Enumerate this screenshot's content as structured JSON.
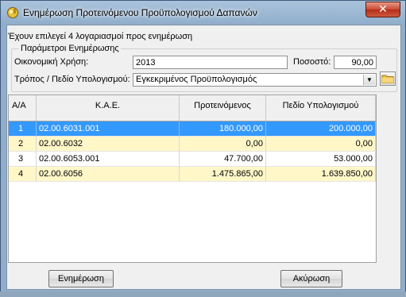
{
  "window": {
    "title": "Ενημέρωση Προτεινόμενου Προϋπολογισμού Δαπανών",
    "close_label": "✕"
  },
  "info_text": "Έχουν επιλεγεί 4 λογαριασμοί προς ενημέρωση",
  "params": {
    "legend": "Παράμετροι Ενημέρωσης",
    "fiscal_year_label": "Οικονομική Χρήση:",
    "fiscal_year_value": "2013",
    "percent_label": "Ποσοστό:",
    "percent_value": "90,00",
    "method_label": "Τρόπος / Πεδίο Υπολογισμού:",
    "method_value": "Εγκεκριμένος Προϋπολογισμός"
  },
  "grid": {
    "columns": [
      "Α/Α",
      "Κ.Α.Ε.",
      "Προτεινόμενος",
      "Πεδίο Υπολογισμού"
    ],
    "rows": [
      {
        "aa": "1",
        "kae": "02.00.6031.001",
        "proposed": "180.000,00",
        "calc": "200.000,00"
      },
      {
        "aa": "2",
        "kae": "02.00.6032",
        "proposed": "0,00",
        "calc": "0,00"
      },
      {
        "aa": "3",
        "kae": "02.00.6053.001",
        "proposed": "47.700,00",
        "calc": "53.000,00"
      },
      {
        "aa": "4",
        "kae": "02.00.6056",
        "proposed": "1.475.865,00",
        "calc": "1.639.850,00"
      }
    ]
  },
  "buttons": {
    "update": "Ενημέρωση",
    "cancel": "Ακύρωση"
  }
}
